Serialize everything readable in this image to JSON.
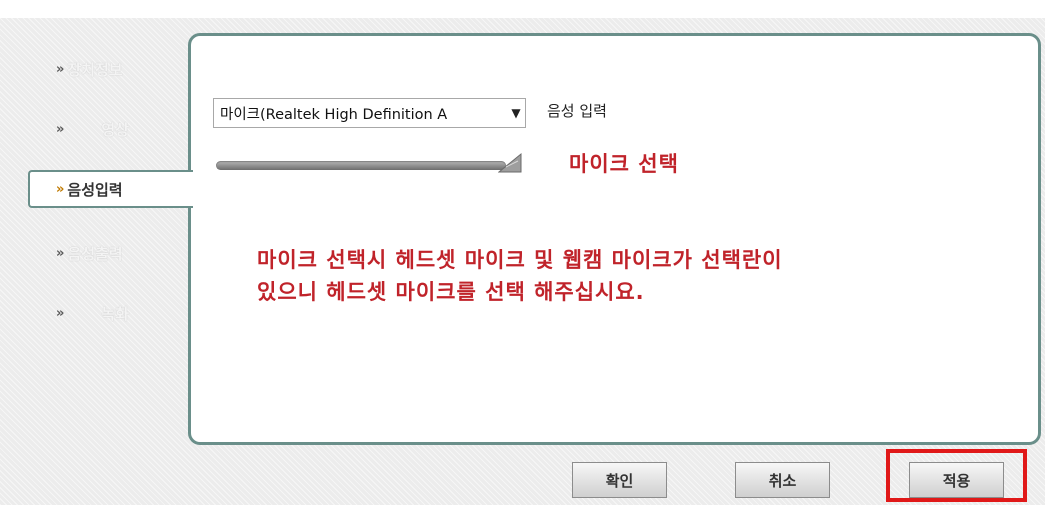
{
  "sidebar": {
    "items": [
      {
        "label": "장치정보",
        "state": "inactive"
      },
      {
        "label": "영상",
        "state": "inactive"
      },
      {
        "label": "음성입력",
        "state": "active"
      },
      {
        "label": "음성출력",
        "state": "inactive"
      },
      {
        "label": "녹화",
        "state": "inactive"
      }
    ],
    "chevron": "»"
  },
  "panel": {
    "device_select": {
      "value": "마이크(Realtek High Definition A",
      "arrow": "▼"
    },
    "input_label": "음성 입력",
    "volume_level": 1.0
  },
  "annotations": {
    "title": "마이크 선택",
    "body_line1": "마이크 선택시 헤드셋 마이크 및 웹캠 마이크가 선택란이",
    "body_line2": "있으니 헤드셋 마이크를 선택 해주십시요."
  },
  "buttons": {
    "ok": "확인",
    "cancel": "취소",
    "apply": "적용"
  },
  "colors": {
    "annotation": "#c0232a",
    "panel_border": "#6a8f8a",
    "highlight": "#e01818",
    "active_chevron": "#c07a00"
  }
}
